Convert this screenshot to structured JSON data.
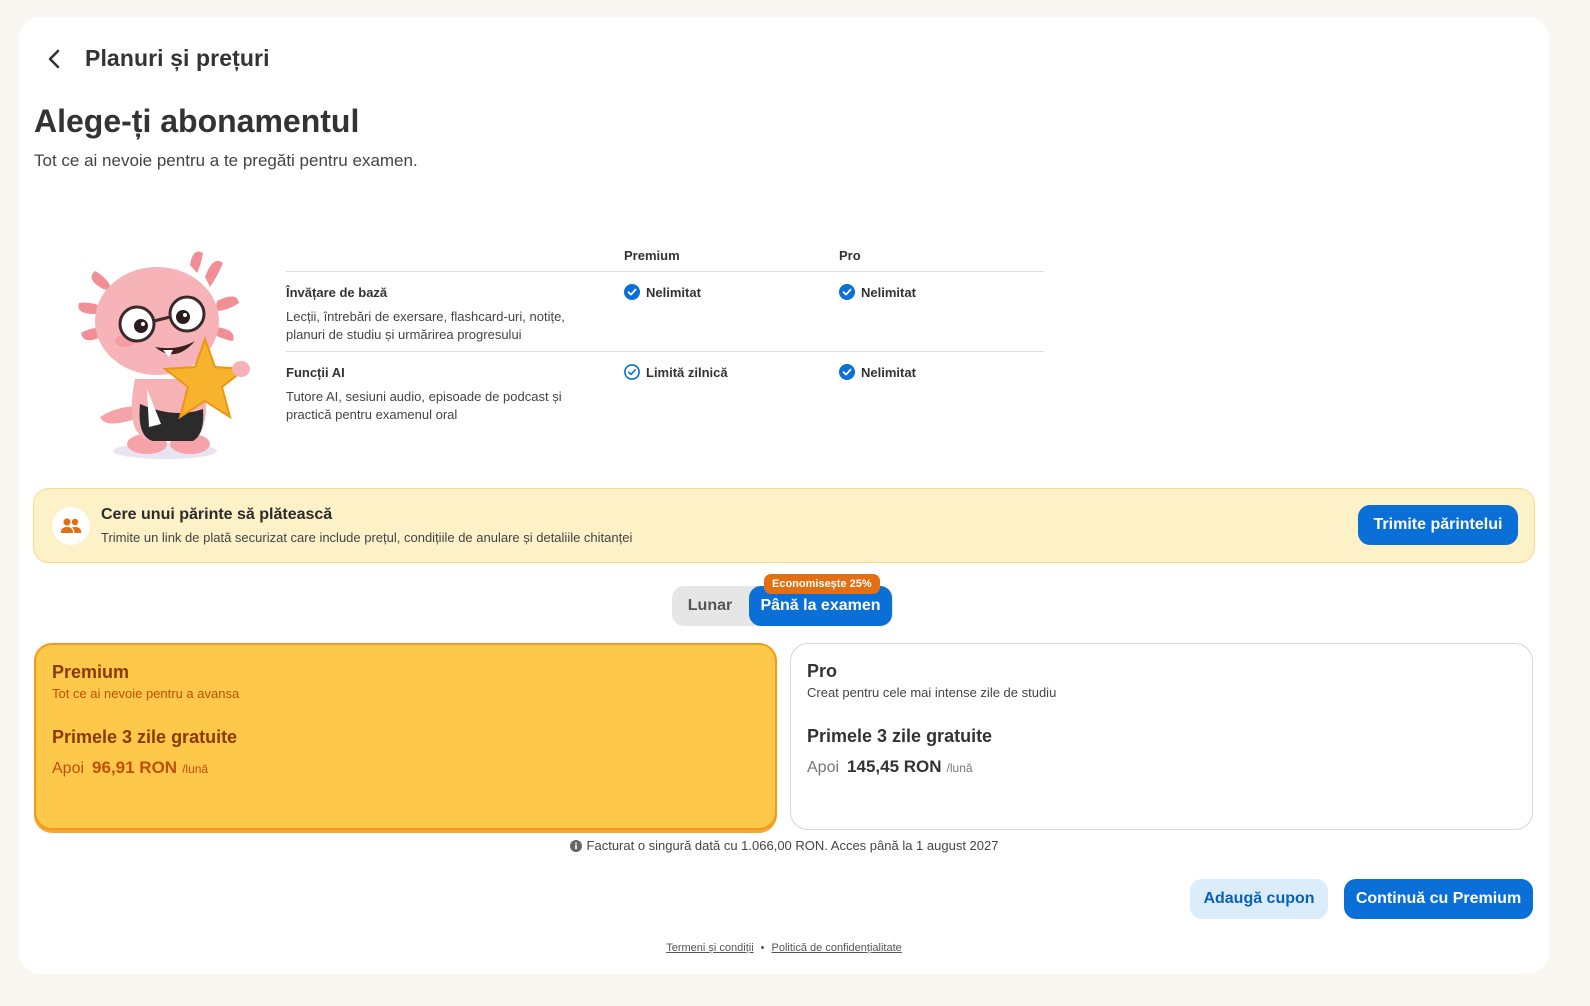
{
  "header": {
    "back_icon": "chevron-left-icon",
    "title": "Planuri și prețuri"
  },
  "intro": {
    "title": "Alege-ți abonamentul",
    "subtitle": "Tot ce ai nevoie pentru a te pregăti pentru examen."
  },
  "comparison": {
    "columns": [
      "Premium",
      "Pro"
    ],
    "rows": [
      {
        "title": "Învățare de bază",
        "description": "Lecții, întrebări de exersare, flashcard-uri, notițe, planuri de studiu și urmărirea progresului",
        "premium": "Nelimitat",
        "pro": "Nelimitat"
      },
      {
        "title": "Funcții AI",
        "description": "Tutore AI, sesiuni audio, episoade de podcast și practică pentru examenul oral",
        "premium": "Limită zilnică",
        "pro": "Nelimitat"
      }
    ]
  },
  "parent_request": {
    "icon": "people-icon",
    "title": "Cere unui părinte să plătească",
    "description": "Trimite un link de plată securizat care include prețul, condițiile de anulare și detaliile chitanței",
    "button_label": "Trimite părintelui"
  },
  "billing_toggle": {
    "options": [
      "Lunar",
      "Până la examen"
    ],
    "selected": "Până la examen",
    "badge": "Economisește 25%"
  },
  "plans": [
    {
      "name": "Premium",
      "tagline": "Tot ce ai nevoie pentru a avansa",
      "trial": "Primele 3 zile gratuite",
      "then_label": "Apoi",
      "price": "96,91 RON",
      "period": "/lună",
      "selected": true
    },
    {
      "name": "Pro",
      "tagline": "Creat pentru cele mai intense zile de studiu",
      "trial": "Primele 3 zile gratuite",
      "then_label": "Apoi",
      "price": "145,45 RON",
      "period": "/lună",
      "selected": false
    }
  ],
  "billing_note": "Facturat o singură dată cu 1.066,00 RON. Acces până la 1 august 2027",
  "actions": {
    "coupon_label": "Adaugă cupon",
    "continue_label": "Continuă cu Premium"
  },
  "footer": {
    "terms": "Termeni și condiții",
    "separator": "•",
    "privacy": "Politică de confidențialitate"
  },
  "colors": {
    "primary": "#0a6fd6",
    "premium_card": "#fec84a",
    "premium_border": "#f39a1a",
    "badge": "#e36f14",
    "parent_box": "#fdf1c8"
  }
}
